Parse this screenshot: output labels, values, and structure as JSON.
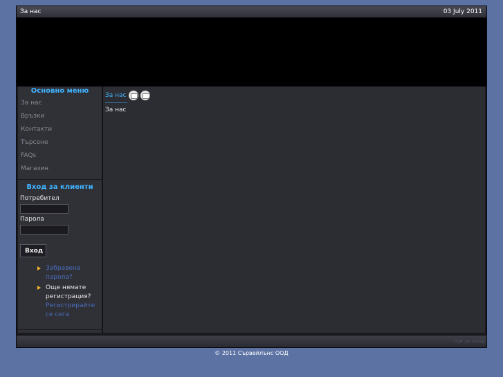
{
  "header": {
    "title": "За нас",
    "date": "03 July 2011"
  },
  "main_menu": {
    "heading": "Основно меню",
    "items": [
      "За нас",
      "Връзки",
      "Контакти",
      "Търсене",
      "FAQs",
      "Магазин"
    ]
  },
  "login": {
    "heading": "Вход за клиенти",
    "username_label": "Потребител",
    "username_value": "",
    "password_label": "Парола",
    "password_value": "",
    "button_label": "Вход",
    "forgot_password": "Забравена парола?",
    "no_account_text": "Още нямате регистрация?",
    "register_link": "Регистрирайте се сега"
  },
  "content": {
    "title": "За нас",
    "body": "За нас",
    "icons": [
      "pdf-icon",
      "print-icon"
    ]
  },
  "bottom": {
    "top_of_page": "TOP OF PAGE"
  },
  "footer": {
    "copyright": "© 2011 Сървейлънс ООД"
  },
  "colors": {
    "background": "#5b72a3",
    "accent": "#3fb4ff",
    "panel": "#303037",
    "bullet": "#f5b323",
    "link": "#4a6fbf"
  }
}
